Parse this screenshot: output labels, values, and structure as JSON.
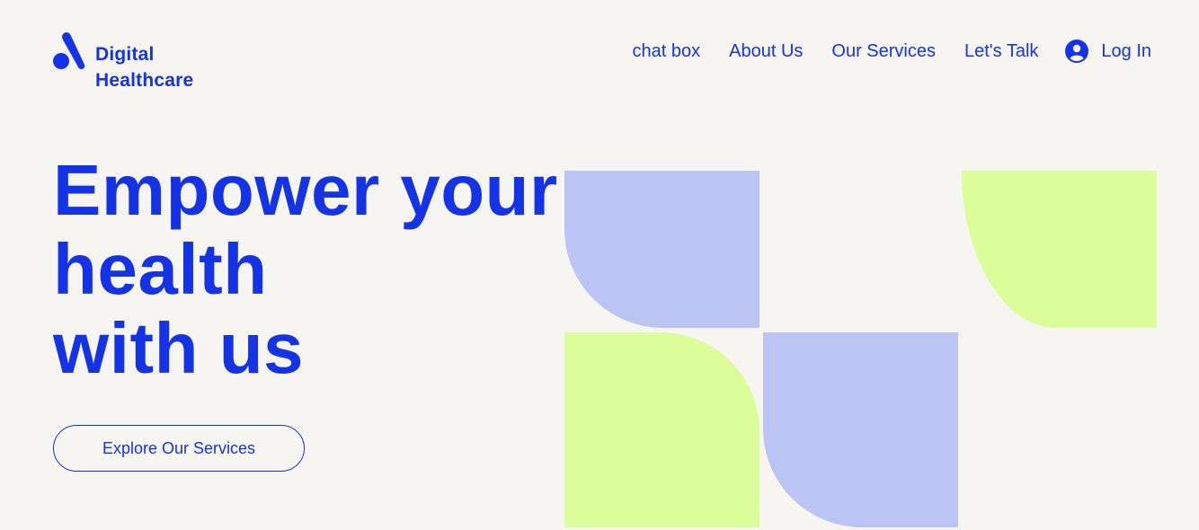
{
  "brand": {
    "name_line1": "Digital",
    "name_line2": "Healthcare",
    "logo_icon": "brand-logo-icon"
  },
  "nav": {
    "items": [
      {
        "label": "chat box"
      },
      {
        "label": "About Us"
      },
      {
        "label": "Our Services"
      },
      {
        "label": "Let's Talk"
      }
    ],
    "login": {
      "label": "Log In",
      "icon": "user-avatar-icon"
    }
  },
  "hero": {
    "title_line1": "Empower your health",
    "title_line2": "with us",
    "cta_label": "Explore Our Services"
  },
  "colors": {
    "background": "#f7f5f2",
    "accent": "#1433e6",
    "lavender": "#bcc4f3",
    "lime": "#dbfd9a"
  }
}
